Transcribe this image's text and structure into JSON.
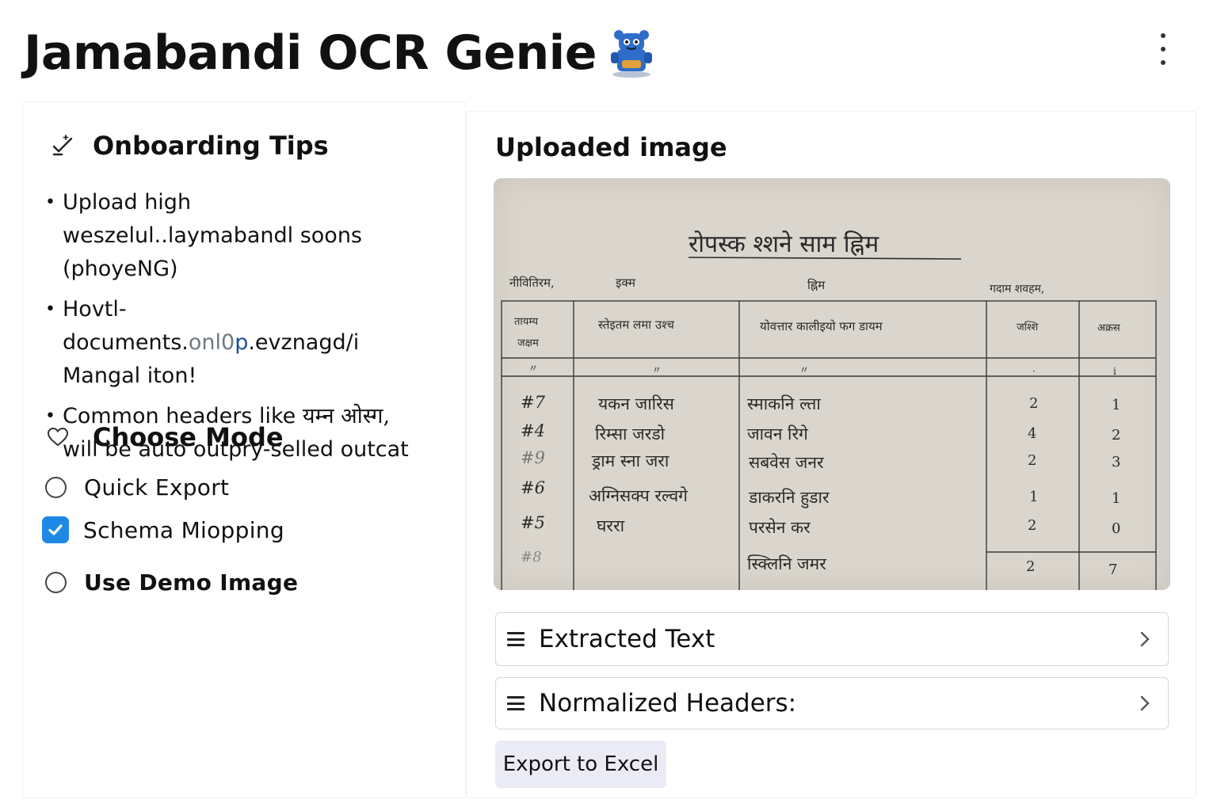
{
  "app": {
    "title": "Jamabandi OCR Genie"
  },
  "sidebar": {
    "tips_heading": "Onboarding Tips",
    "tips": [
      {
        "text": "Upload high weszelul..laymabandl soons (phoyeNG)"
      },
      {
        "before": "Hovtl-documents.",
        "muted": "onl0",
        "accent": "p",
        "after": ".evznagd/i Mangal iton!"
      },
      {
        "before": "Common headers like ",
        "deva": "यम्न ओस्ग,",
        "after": " will be auto outpry-selled outcat"
      }
    ],
    "mode_heading": "Choose Mode",
    "modes": [
      {
        "label": "Quick Export",
        "checked": false
      },
      {
        "label": "Schema Miopping",
        "checked": true
      },
      {
        "label": "Use Demo Image",
        "checked": false
      }
    ]
  },
  "main": {
    "title": "Uploaded image",
    "document": {
      "heading": "रोपस्क श्शने साम ह्निम",
      "top_labels": [
        "नीवितिरम,",
        "इक्म",
        "ह्निम",
        "गदाम शवहम,"
      ],
      "column_headers": [
        [
          "तायम्य",
          "जक्षम"
        ],
        [
          "स्तेइतम लमा उश्च"
        ],
        [
          "योवत्तार कालीइयो फग डायम"
        ],
        [
          "जश्शि"
        ],
        [
          "अक्रस"
        ]
      ],
      "ditto_marks": [
        "〃",
        "〃",
        "〃",
        "·",
        "ⅰ"
      ],
      "rows": [
        [
          "#7",
          "यकन जारिस",
          "स्माकनि ल्ता",
          "2",
          "1"
        ],
        [
          "#4",
          "रिम्सा जरडो",
          "जावन रिगे",
          "4",
          "2"
        ],
        [
          "#9",
          "ड्राम स्ना जरा",
          "सबवेस जनर",
          "2",
          "3"
        ],
        [
          "#6",
          "अग्निसक्प रल्वगे",
          "डाकरनि हुडार",
          "1",
          "1"
        ],
        [
          "#5",
          "घररा",
          "परसेन कर",
          "2",
          "0"
        ],
        [
          "#8",
          "",
          "स्क्लिनि जमर",
          "2",
          "7"
        ]
      ]
    },
    "expanders": [
      {
        "label": "Extracted Text"
      },
      {
        "label": "Normalized Headers:"
      }
    ],
    "export_label": "Export to Excel"
  }
}
